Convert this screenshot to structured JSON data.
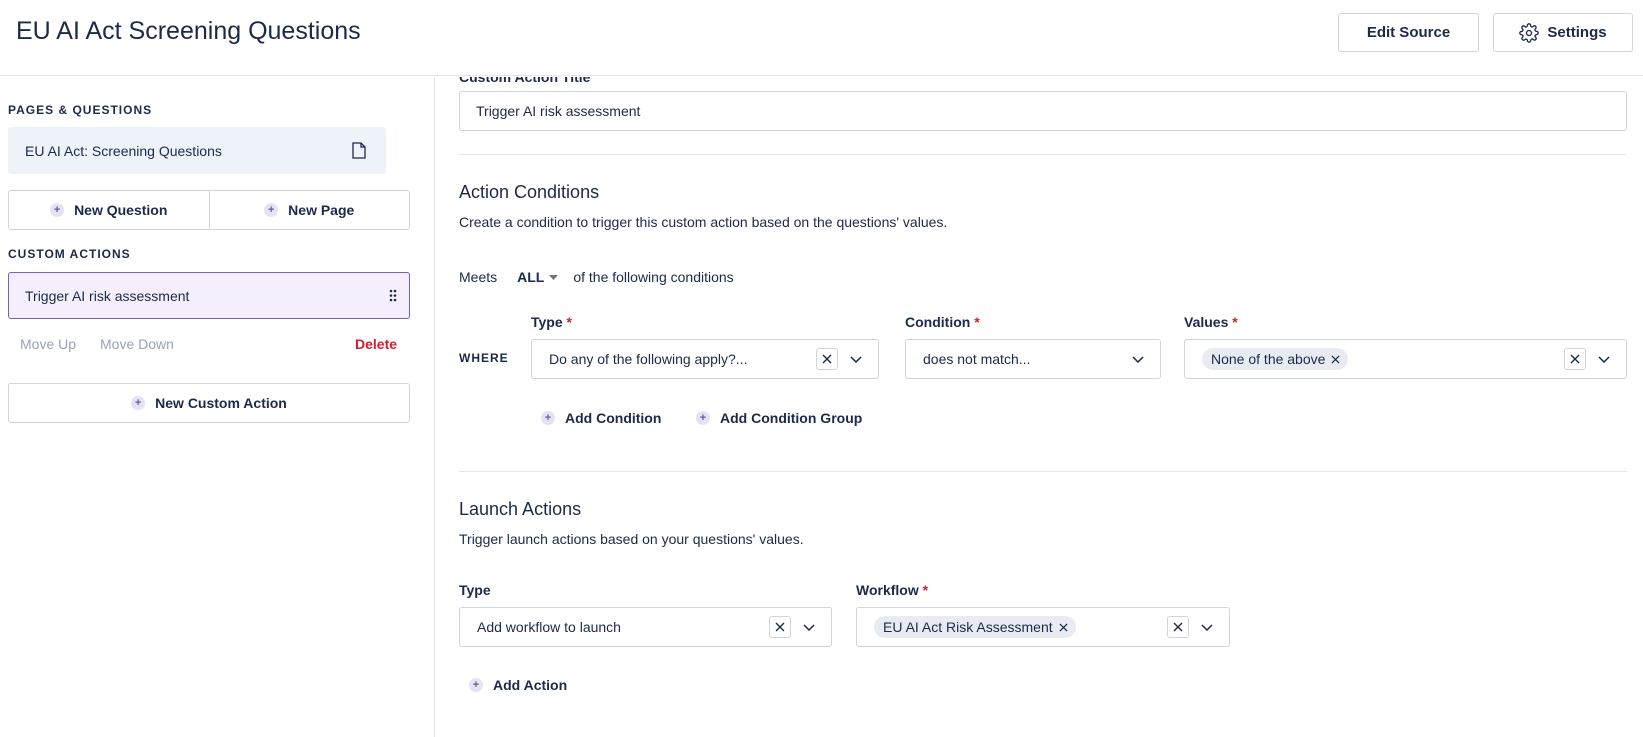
{
  "header": {
    "title": "EU AI Act Screening Questions",
    "edit_source_label": "Edit Source",
    "settings_label": "Settings"
  },
  "sidebar": {
    "pages_label": "PAGES & QUESTIONS",
    "page_item": "EU AI Act: Screening Questions",
    "new_question_label": "New Question",
    "new_page_label": "New Page",
    "custom_actions_label": "CUSTOM ACTIONS",
    "custom_action_item": "Trigger AI risk assessment",
    "move_up_label": "Move Up",
    "move_down_label": "Move Down",
    "delete_label": "Delete",
    "new_custom_action_label": "New Custom Action"
  },
  "main": {
    "title_field_label": "Custom Action Title",
    "title_value": "Trigger AI risk assessment",
    "conditions": {
      "heading": "Action Conditions",
      "description": "Create a condition to trigger this custom action based on the questions' values.",
      "meets_label": "Meets",
      "meets_value": "ALL",
      "meets_suffix": "of the following conditions",
      "where_label": "WHERE",
      "type_label": "Type",
      "type_value": "Do any of the following apply?...",
      "condition_label": "Condition",
      "condition_value": "does not match...",
      "values_label": "Values",
      "values_chip": "None of the above",
      "add_condition_label": "Add Condition",
      "add_condition_group_label": "Add Condition Group"
    },
    "launch": {
      "heading": "Launch Actions",
      "description": "Trigger launch actions based on your questions' values.",
      "type_label": "Type",
      "type_value": "Add workflow to launch",
      "workflow_label": "Workflow",
      "workflow_chip": "EU AI Act Risk Assessment",
      "add_action_label": "Add Action"
    }
  },
  "required_mark": "*",
  "colors": {
    "text": "#1b2a4a",
    "required": "#d0202f",
    "selected_border": "#7b5cc2",
    "selected_bg": "#f5effc",
    "page_item_bg": "#eef3fa"
  }
}
